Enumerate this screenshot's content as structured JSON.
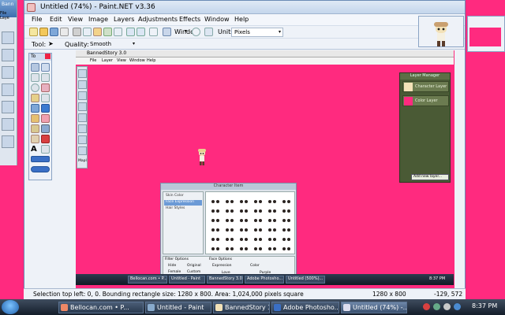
{
  "bg_app": {
    "title": "Bann",
    "menu": [
      "File",
      "Laye"
    ]
  },
  "window": {
    "title": "Untitled (74%) - Paint.NET v3.36"
  },
  "menu": [
    "File",
    "Edit",
    "View",
    "Image",
    "Layers",
    "Adjustments",
    "Effects",
    "Window",
    "Help"
  ],
  "toolbar": {
    "window_label": "Window",
    "units_label": "Units:",
    "units_value": "Pixels",
    "tool_label": "Tool:",
    "quality_label": "Quality:",
    "quality_value": "Smooth"
  },
  "tools_panel": {
    "title": "To"
  },
  "mini": {
    "title": "BannedStory 3.0",
    "menu": [
      "File",
      "Layer",
      "View",
      "Window",
      "Help"
    ],
    "left_label": "Mapl"
  },
  "layer_manager": {
    "title": "Layer Manager",
    "layers": [
      "Character Layer",
      "Color Layer"
    ],
    "add_label": "Add new layer..."
  },
  "char_dialog": {
    "title": "Character Item",
    "list": [
      "Skin Color",
      "Face Expression",
      "Hair Styles"
    ],
    "footer": [
      "Filter Options",
      "Hide",
      "Original",
      "Female",
      "Custom",
      "Face Options",
      "Expression",
      "Color",
      "Love",
      "Purple"
    ]
  },
  "mini_taskbar": [
    "Bellocan.com • P...",
    "Untitled - Paint",
    "BannedStory 3.0",
    "Adobe Photosho...",
    "Untitled (500%)...",
    "8:37 PM"
  ],
  "statusbar": {
    "selection": "Selection top left: 0, 0. Bounding rectangle size: 1280 x 800. Area: 1,024,000 pixels square",
    "size": "1280 x 800",
    "coords": "-129, 572"
  },
  "taskbar": {
    "items": [
      "Bellocan.com • P...",
      "Untitled - Paint",
      "BannedStory 3.0",
      "Adobe Photosho...",
      "Untitled (74%) -..."
    ],
    "clock": "8:37 PM"
  }
}
